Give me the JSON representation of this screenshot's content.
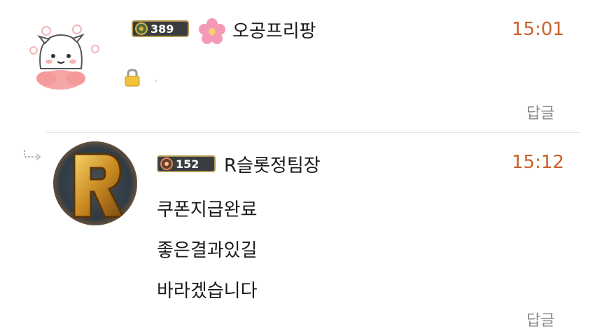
{
  "comments": [
    {
      "level": "389",
      "nickname": "오공프리팡",
      "time": "15:01",
      "reply_label": "답글",
      "body_lines": []
    },
    {
      "level": "152",
      "nickname": "R슬롯정팀장",
      "time": "15:12",
      "reply_label": "답글",
      "body_lines": [
        "쿠폰지급완료",
        "좋은결과있길",
        "바라겠습니다"
      ]
    }
  ],
  "colors": {
    "time": "#c8622a",
    "reply": "#8a8a8a",
    "badge_bg": "#3a3d3f"
  },
  "icons": [
    "level-badge-icon",
    "flower-icon",
    "lock-icon",
    "reply-arrow-icon"
  ]
}
